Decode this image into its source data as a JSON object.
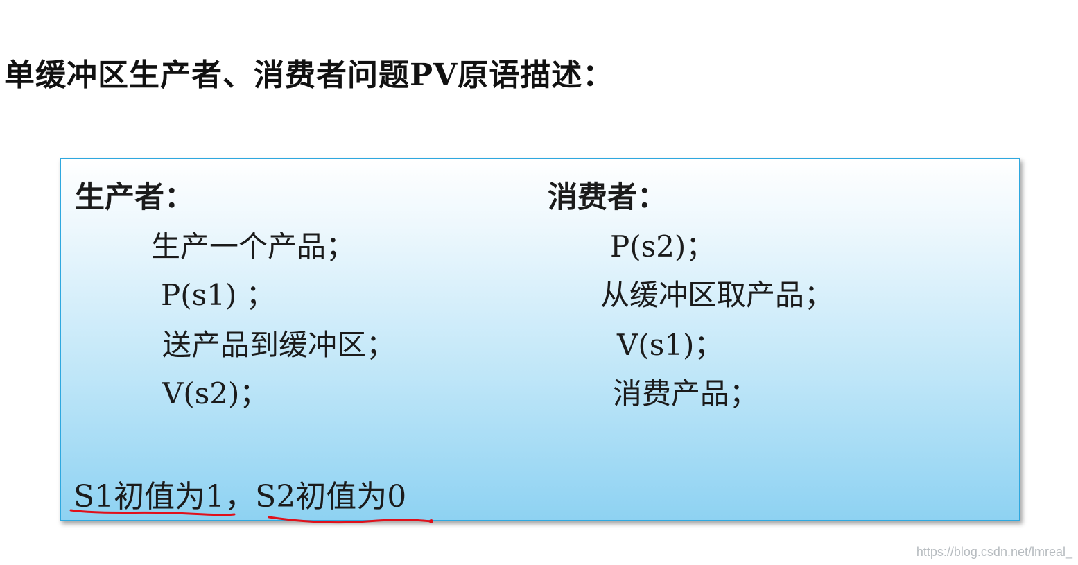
{
  "title": "单缓冲区生产者、消费者问题PV原语描述：",
  "producer": {
    "heading": "生产者：",
    "steps": [
      "生产一个产品；",
      "P(s1) ；",
      "送产品到缓冲区；",
      "V(s2)；"
    ]
  },
  "consumer": {
    "heading": "消费者：",
    "steps": [
      "P(s2)；",
      "从缓冲区取产品；",
      "V(s1)；",
      "消费产品；"
    ]
  },
  "init_note": "S1初值为1，S2初值为0",
  "watermark": "https://blog.csdn.net/lmreal_",
  "colors": {
    "panel_border": "#2fa8df",
    "panel_fill_bottom": "#8ed2f2",
    "underline": "#e0101a"
  }
}
